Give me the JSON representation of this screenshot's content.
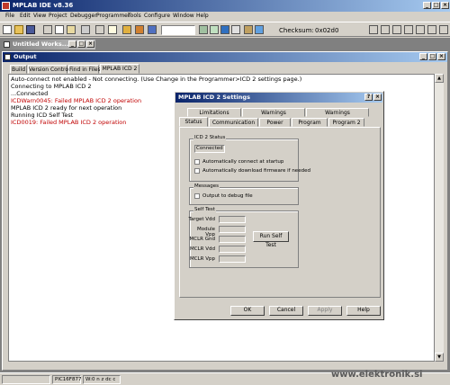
{
  "app": {
    "title": "MPLAB IDE v8.36",
    "menu": [
      "File",
      "Edit",
      "View",
      "Project",
      "Debugger",
      "Programmer",
      "Tools",
      "Configure",
      "Window",
      "Help"
    ],
    "checksum_label": "Checksum:",
    "checksum_value": "0x02d0"
  },
  "workspace": {
    "title": "Untitled Works..."
  },
  "output": {
    "title": "Output",
    "tabs": [
      "Build",
      "Version Control",
      "Find in Files",
      "MPLAB ICD 2"
    ],
    "lines": [
      {
        "text": "Auto-connect not enabled - Not connecting. (Use Change in the Programmer>ICD 2 settings page.)",
        "red": false
      },
      {
        "text": "Connecting to MPLAB ICD 2",
        "red": false
      },
      {
        "text": "...Connected",
        "red": false
      },
      {
        "text": "ICDWarn0045: Failed MPLAB ICD 2 operation",
        "red": true
      },
      {
        "text": "MPLAB ICD 2 ready for next operation",
        "red": false
      },
      {
        "text": "Running ICD Self Test",
        "red": false
      },
      {
        "text": "ICD0019: Failed MPLAB ICD 2 operation",
        "red": true
      }
    ]
  },
  "dialog": {
    "title": "MPLAB ICD 2 Settings",
    "tabs_back": [
      "Limitations",
      "Warnings",
      "Warnings"
    ],
    "tabs_front": [
      "Status",
      "Communication",
      "Power",
      "Program",
      "Program 2"
    ],
    "status_group": "ICD 2 Status",
    "status_value": "Connected",
    "checkbox1": "Automatically connect at startup",
    "checkbox2": "Automatically download firmware if needed",
    "messages_group": "Messages",
    "checkbox3": "Output to debug file",
    "selftest_group": "Self Test",
    "fields": [
      "Target Vdd",
      "Module Vpp",
      "MCLR Gnd",
      "MCLR Vdd",
      "MCLR Vpp"
    ],
    "run_button": "Run Self Test",
    "buttons": [
      "OK",
      "Cancel",
      "Apply",
      "Help"
    ]
  },
  "statusbar": {
    "items": [
      "PIC16F877",
      "W:0 n z dc c"
    ]
  },
  "watermark": "www.elektronik.si"
}
